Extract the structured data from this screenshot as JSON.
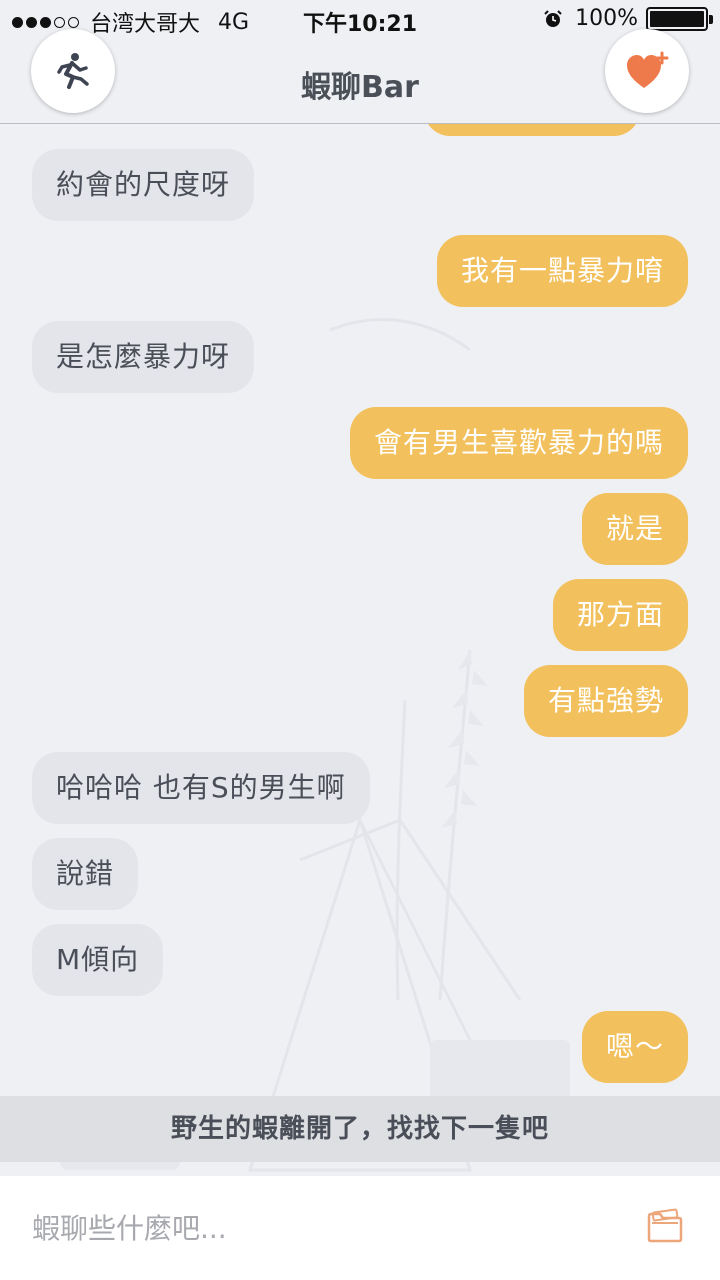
{
  "status_bar": {
    "carrier": "台湾大哥大",
    "network": "4G",
    "time": "下午10:21",
    "battery": "100%",
    "signal_bars": 3,
    "signal_total": 5,
    "icons": [
      "alarm-icon",
      "battery-icon"
    ]
  },
  "nav": {
    "title": "蝦聊Bar",
    "left_button_icon": "running-person-icon",
    "right_button_icon": "heart-plus-icon"
  },
  "colors": {
    "incoming_bubble": "#e4e5ea",
    "outgoing_bubble": "#f2c05c",
    "accent_heart": "#ee7a4c",
    "background": "#eef0f4"
  },
  "messages": [
    {
      "side": "in",
      "text": "約會的尺度呀"
    },
    {
      "side": "out",
      "text": "我有一點暴力唷"
    },
    {
      "side": "in",
      "text": "是怎麼暴力呀"
    },
    {
      "side": "out",
      "text": "會有男生喜歡暴力的嗎"
    },
    {
      "side": "out",
      "text": "就是"
    },
    {
      "side": "out",
      "text": "那方面"
    },
    {
      "side": "out",
      "text": "有點強勢"
    },
    {
      "side": "in",
      "text": "哈哈哈 也有S的男生啊"
    },
    {
      "side": "in",
      "text": "說錯"
    },
    {
      "side": "in",
      "text": "M傾向"
    },
    {
      "side": "out",
      "text": "嗯～"
    }
  ],
  "notice": "野生的蝦離開了，找找下一隻吧",
  "input": {
    "value": "",
    "placeholder": "蝦聊些什麼吧...",
    "attach_icon": "folder-icon"
  }
}
